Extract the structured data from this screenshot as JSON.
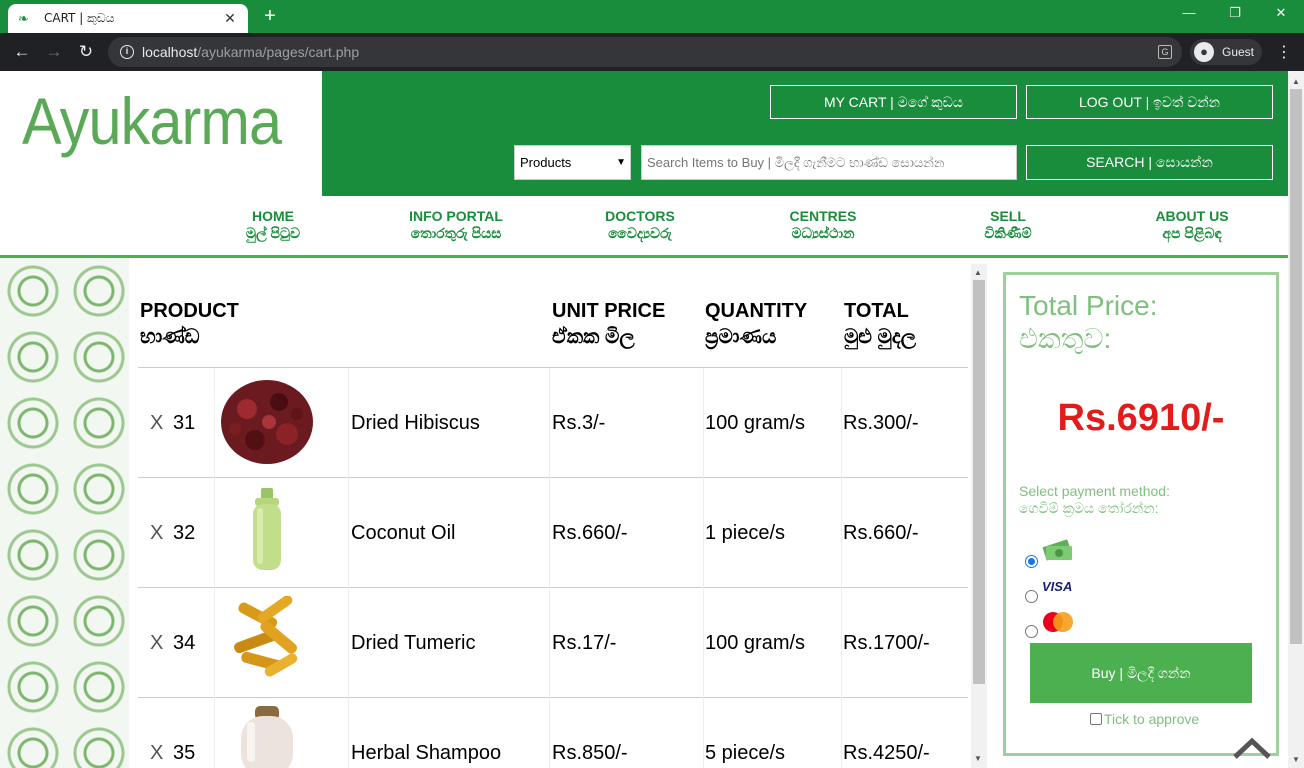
{
  "browser": {
    "tab_title": "CART | කුඩය",
    "tab_close": "✕",
    "new_tab": "+",
    "url_host": "localhost",
    "url_path": "/ayukarma/pages/cart.php",
    "profile": "Guest"
  },
  "header": {
    "logo": "Ayukarma",
    "my_cart": "MY CART  |  මගේ කුඩය",
    "logout": "LOG OUT  |  ඉවත් වන්න",
    "category_selected": "Products",
    "search_placeholder": "Search Items to Buy | මිලදී ගැනීමට භාණ්ඩ සොයන්න",
    "search_button": "SEARCH  |  සොයන්න"
  },
  "nav": [
    {
      "en": "HOME",
      "si": "මුල් පිටුව"
    },
    {
      "en": "INFO PORTAL",
      "si": "තොරතුරු පියස"
    },
    {
      "en": "DOCTORS",
      "si": "වෛද්‍යවරු"
    },
    {
      "en": "CENTRES",
      "si": "මධ්‍යස්ථාන"
    },
    {
      "en": "SELL",
      "si": "විකිණීම්"
    },
    {
      "en": "ABOUT US",
      "si": "අප පිළිබඳ"
    }
  ],
  "table": {
    "headers": {
      "product_en": "PRODUCT",
      "product_si": "භාණ්ඩ",
      "unit_en": "UNIT PRICE",
      "unit_si": "ඒකක මිල",
      "qty_en": "QUANTITY",
      "qty_si": "ප්‍රමාණය",
      "total_en": "TOTAL",
      "total_si": "මුළු මුදල"
    },
    "remove_symbol": "X",
    "rows": [
      {
        "id": "31",
        "name": "Dried Hibiscus",
        "unit": "Rs.3/-",
        "qty": "100 gram/s",
        "total": "Rs.300/-"
      },
      {
        "id": "32",
        "name": "Coconut Oil",
        "unit": "Rs.660/-",
        "qty": "1 piece/s",
        "total": "Rs.660/-"
      },
      {
        "id": "34",
        "name": "Dried Tumeric",
        "unit": "Rs.17/-",
        "qty": "100 gram/s",
        "total": "Rs.1700/-"
      },
      {
        "id": "35",
        "name": "Herbal Shampoo",
        "unit": "Rs.850/-",
        "qty": "5 piece/s",
        "total": "Rs.4250/-"
      }
    ]
  },
  "summary": {
    "title_en": "Total Price:",
    "title_si": "එකතුව:",
    "amount": "Rs.6910/-",
    "payment_en": "Select payment method:",
    "payment_si": "ගෙවීම් ක්‍රමය තෝරන්න:",
    "visa": "VISA",
    "buy_button": "Buy | මිලදී ගන්න",
    "approve": "Tick to approve"
  },
  "icons": {
    "favicon": "cart-leaf-icon",
    "back": "arrow-left-icon",
    "forward": "arrow-right-icon",
    "reload": "reload-icon",
    "site_info": "info-icon",
    "translate": "translate-icon",
    "scroll_top": "chevron-up-icon"
  },
  "colors": {
    "brand_green": "#1a8d3c",
    "logo_green": "#5aa957",
    "total_red": "#e31b1b"
  }
}
